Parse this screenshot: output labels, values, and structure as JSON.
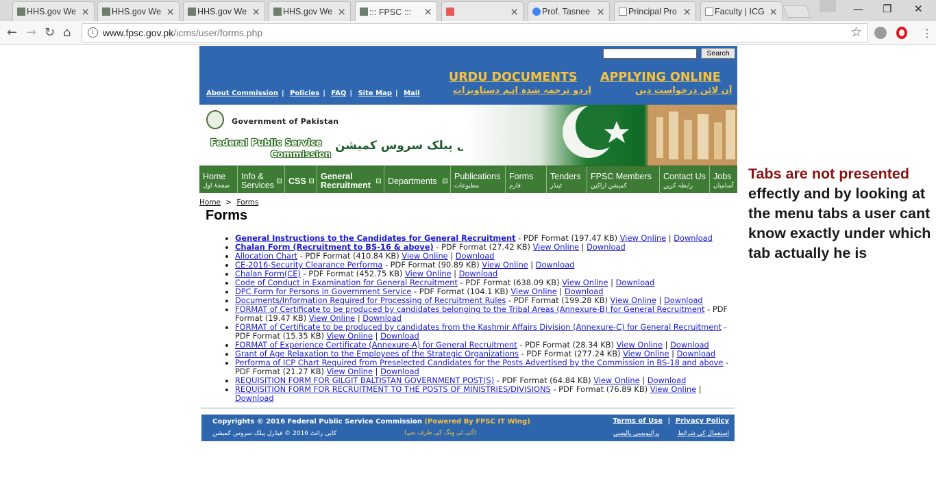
{
  "browser": {
    "tabs": [
      {
        "title": "HHS.gov We",
        "icon": "hhs-eagle-icon"
      },
      {
        "title": "HHS.gov We",
        "icon": "hhs-eagle-icon"
      },
      {
        "title": "HHS.gov We",
        "icon": "hhs-eagle-icon"
      },
      {
        "title": "HHS.gov We",
        "icon": "hhs-eagle-icon"
      },
      {
        "title": "::: FPSC :::",
        "icon": "fpsc-emblem-icon",
        "active": true
      },
      {
        "title": "",
        "icon": "blurred-favicon-icon"
      },
      {
        "title": "Prof. Tasnee",
        "icon": "google-icon"
      },
      {
        "title": "Principal Pro",
        "icon": "document-icon"
      },
      {
        "title": "Faculty | ICG",
        "icon": "document-icon"
      }
    ],
    "url_host": "www.fpsc.gov.pk",
    "url_path": "/icms/user/forms.php",
    "window_controls": {
      "minimize": "—",
      "restore": "❐",
      "close": "✕"
    }
  },
  "header": {
    "search_button": "Search",
    "urdu_documents": "URDU DOCUMENTS",
    "urdu_documents_urdu": "اردو ترجمہ شدہ اہم دستاویزات",
    "applying_online": "APPLYING ONLINE",
    "applying_online_urdu": "آن لائن درخواست دیں",
    "top_links": [
      "About Commission",
      "Policies",
      "FAQ",
      "Site Map",
      "Mail"
    ]
  },
  "banner": {
    "government": "Government of Pakistan",
    "fpsc_line1": "Federal Public Service",
    "fpsc_line2": "Commission",
    "fpsc_urdu": "فیڈرل پبلک سروس کمیشن"
  },
  "main_nav": [
    {
      "en": "Home",
      "ur": "صفحۂ اول",
      "bold": false,
      "plus": false
    },
    {
      "en": "Info &",
      "en2": "Services",
      "ur": "",
      "bold": false,
      "plus": true
    },
    {
      "en": "CSS",
      "ur": "",
      "bold": true,
      "plus": true
    },
    {
      "en": "General",
      "en2": "Recruitment",
      "ur": "",
      "bold": true,
      "plus": true
    },
    {
      "en": "Departments",
      "ur": "",
      "bold": false,
      "plus": true
    },
    {
      "en": "Publications",
      "ur": "مطبوعات",
      "bold": false,
      "plus": false
    },
    {
      "en": "Forms",
      "ur": "فارم",
      "bold": false,
      "plus": false
    },
    {
      "en": "Tenders",
      "ur": "ٹینڈر",
      "bold": false,
      "plus": false
    },
    {
      "en": "FPSC Members",
      "ur": "کمیشن اراکین",
      "bold": false,
      "plus": false
    },
    {
      "en": "Contact Us",
      "ur": "رابطہ کریں",
      "bold": false,
      "plus": false
    },
    {
      "en": "Jobs",
      "ur": "آسامیاں",
      "bold": false,
      "plus": false
    }
  ],
  "breadcrumb": {
    "home": "Home",
    "sep": ">",
    "current": "Forms"
  },
  "page_title": "Forms",
  "forms": [
    {
      "title": "General Instructions to the Candidates for General Recruitment",
      "bold": true,
      "meta": " - PDF Format (197.47 KB) "
    },
    {
      "title": "Chalan Form (Recruitment to BS-16 & above)",
      "bold": true,
      "meta": " - PDF Format (27.42 KB) "
    },
    {
      "title": "Allocation Chart",
      "bold": false,
      "meta": " - PDF Format (410.84 KB) "
    },
    {
      "title": "CE-2016-Security Clearance Performa",
      "bold": false,
      "meta": " - PDF Format (90.89 KB) "
    },
    {
      "title": "Chalan Form(CE)",
      "bold": false,
      "meta": " - PDF Format (452.75 KB) "
    },
    {
      "title": "Code of Conduct in Examination for General Recruitment",
      "bold": false,
      "meta": " - PDF Format (638.09 KB) "
    },
    {
      "title": "DPC Form for Persons in Government Service",
      "bold": false,
      "meta": " - PDF Format (104.1 KB) "
    },
    {
      "title": "Documents/Information Required for Processing of Recruitment Rules",
      "bold": false,
      "meta": " - PDF Format (199.28 KB) "
    },
    {
      "title": "FORMAT of Certificate to be produced by candidates belonging to the Tribal Areas (Annexure-B) for General Recruitment",
      "bold": false,
      "meta": " - PDF Format (19.47 KB) "
    },
    {
      "title": "FORMAT of Certificate to be produced by candidates from the Kashmir Affairs Division (Annexure-C) for General Recruitment",
      "bold": false,
      "meta": " - PDF Format (15.35 KB) "
    },
    {
      "title": "FORMAT of Experience Certificate (Annexure-A) for General Recruitment",
      "bold": false,
      "meta": " - PDF Format (28.34 KB) "
    },
    {
      "title": "Grant of Age Relaxation to the Employees of the Strategic Organizations",
      "bold": false,
      "meta": " - PDF Format (277.24 KB) "
    },
    {
      "title": "Performa of ICP Chart Required from Preselected Candidates for the Posts Advertised by the Commission in BS-18 and above",
      "bold": false,
      "meta": " - PDF Format (21.27 KB) "
    },
    {
      "title": "REQUISITION FORM FOR GILGIT BALTISTAN GOVERNMENT POST(S)",
      "bold": false,
      "meta": " - PDF Format (64.84 KB) "
    },
    {
      "title": "REQUISITION FORM FOR RECRUITMENT TO THE POSTS OF MINISTRIES/DIVISIONS",
      "bold": false,
      "meta": " - PDF Format (76.89 KB) "
    }
  ],
  "form_actions": {
    "view": "View Online",
    "sep": " | ",
    "download": "Download"
  },
  "footer": {
    "copyright": "Copyrights © 2016 Federal Public Service Commission ",
    "powered": "(Powered By FPSC IT Wing)",
    "copyright_urdu": "کاپی رائٹ 2016 © فیڈرل پبلک سروس کمیشن",
    "powered_urdu": "(آئی ٹی ونگ کی طرف سے)",
    "terms": "Terms of Use",
    "privacy": "Privacy Policy",
    "terms_urdu": "استعمال کی شرائط",
    "privacy_urdu": "پرائیویسی پالیسی"
  },
  "annotation": {
    "line1": "Tabs are not presented",
    "rest": "effectly and by looking at the menu tabs a user cant know exactly under which tab actually he is"
  },
  "colors": {
    "header_blue": "#2f68b0",
    "nav_green": "#3e7b35",
    "link_blue": "#1a1ad6",
    "gold": "#f9c23c",
    "annotation_red": "#8b1212"
  }
}
